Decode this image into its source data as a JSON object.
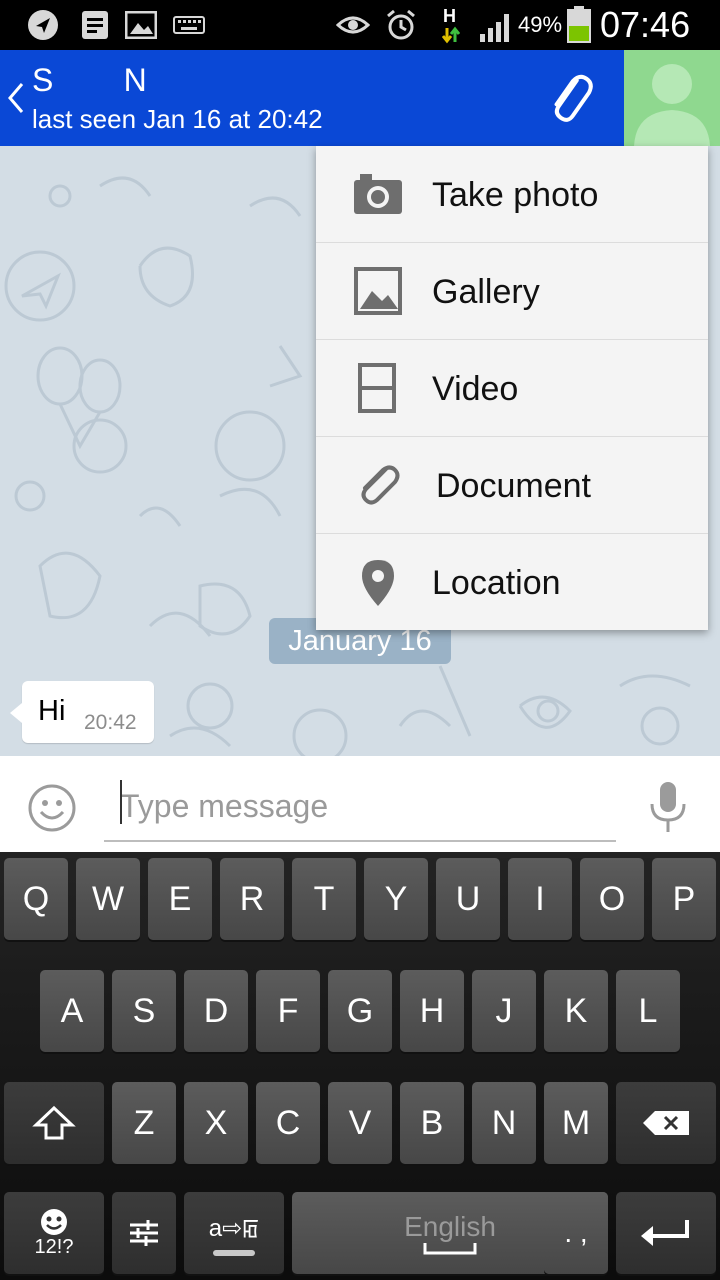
{
  "status_bar": {
    "icons": [
      "navigation-icon",
      "notes-icon",
      "image-icon",
      "keyboard-icon",
      "eye-icon",
      "alarm-icon",
      "network-h-icon",
      "signal-icon",
      "battery-icon"
    ],
    "network_label": "H",
    "battery": "49%",
    "time": "07:46"
  },
  "header": {
    "contact_name": "S       N",
    "last_seen": "last seen Jan 16 at 20:42",
    "accent_color": "#0a48d6"
  },
  "attach_menu": {
    "items": [
      {
        "label": "Take photo",
        "icon": "camera-icon"
      },
      {
        "label": "Gallery",
        "icon": "gallery-icon"
      },
      {
        "label": "Video",
        "icon": "video-icon"
      },
      {
        "label": "Document",
        "icon": "paperclip-icon"
      },
      {
        "label": "Location",
        "icon": "location-pin-icon"
      }
    ]
  },
  "chat": {
    "date_badge": "January 16",
    "messages": [
      {
        "text": "Hi",
        "time": "20:42"
      }
    ]
  },
  "input": {
    "placeholder": "Type message"
  },
  "keyboard": {
    "row1": [
      "Q",
      "W",
      "E",
      "R",
      "T",
      "Y",
      "U",
      "I",
      "O",
      "P"
    ],
    "row2": [
      "A",
      "S",
      "D",
      "F",
      "G",
      "H",
      "J",
      "K",
      "L"
    ],
    "row3": [
      "Z",
      "X",
      "C",
      "V",
      "B",
      "N",
      "M"
    ],
    "symbols_label": "12!?",
    "lang_switch_label": "a⇨ꡂ",
    "space_label": "English",
    "punct_label": ". ,"
  }
}
